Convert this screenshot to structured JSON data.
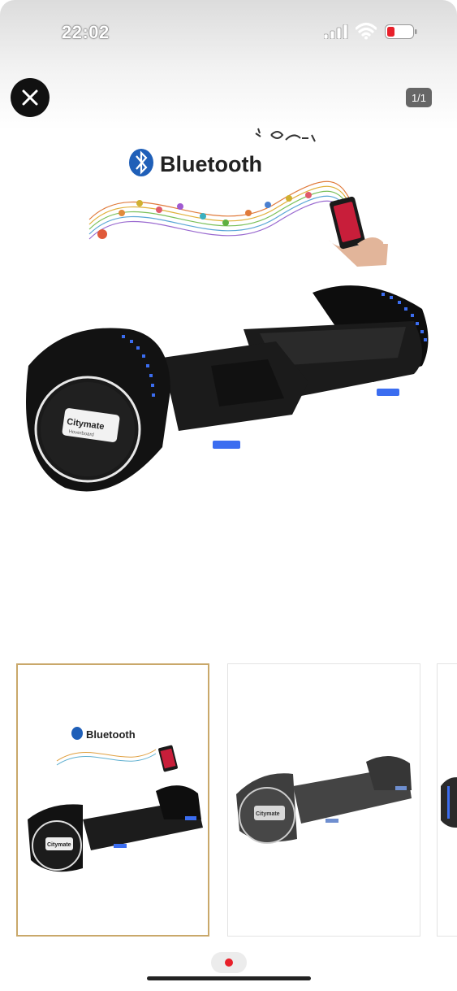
{
  "status_bar": {
    "time": "22:02",
    "icons": [
      "signal-icon",
      "wifi-icon",
      "battery-low-icon"
    ]
  },
  "viewer": {
    "close_icon": "close-icon",
    "counter": "1/1"
  },
  "product_image": {
    "banner_text": "Bluetooth",
    "logo_text": "Citymate",
    "logo_subtext": "Hoverboard"
  },
  "thumbnails": [
    {
      "label": "thumbnail-1",
      "selected": true,
      "banner_text": "Bluetooth",
      "logo_text": "Citymate"
    },
    {
      "label": "thumbnail-2",
      "selected": false,
      "logo_text": "Citymate"
    },
    {
      "label": "thumbnail-3",
      "selected": false
    }
  ],
  "pager": {
    "active_index": 0,
    "dot_color": "#e8202a"
  },
  "colors": {
    "close_bg": "#111111",
    "selected_border": "#c9a86a",
    "led_blue": "#3b6df0",
    "bluetooth_blue": "#1f5fb8"
  }
}
